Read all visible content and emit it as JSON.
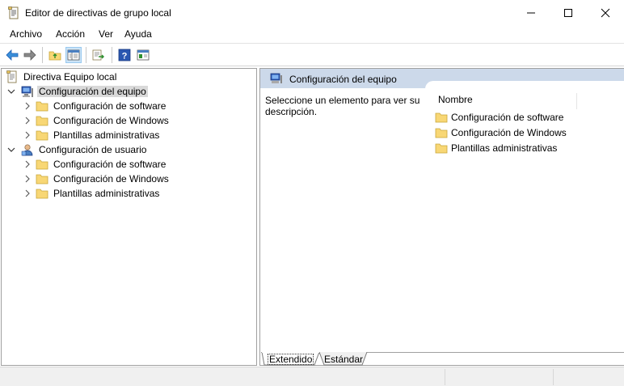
{
  "window": {
    "title": "Editor de directivas de grupo local",
    "controls": [
      "minimize",
      "maximize",
      "close"
    ]
  },
  "menu": {
    "items": [
      "Archivo",
      "Acción",
      "Ver",
      "Ayuda"
    ]
  },
  "toolbar": {
    "buttons": [
      "back-icon",
      "forward-icon",
      "up-folder-icon",
      "show-hide-tree-icon",
      "export-list-icon",
      "help-icon",
      "properties-icon"
    ]
  },
  "tree": {
    "root": "Directiva Equipo local",
    "computer": {
      "label": "Configuración del equipo",
      "children": [
        "Configuración de software",
        "Configuración de Windows",
        "Plantillas administrativas"
      ]
    },
    "user": {
      "label": "Configuración de usuario",
      "children": [
        "Configuración de software",
        "Configuración de Windows",
        "Plantillas administrativas"
      ]
    }
  },
  "details": {
    "header": "Configuración del equipo",
    "description": "Seleccione un elemento para ver su descripción.",
    "column": "Nombre",
    "items": [
      "Configuración de software",
      "Configuración de Windows",
      "Plantillas administrativas"
    ]
  },
  "tabs": {
    "extended": "Extendido",
    "standard": "Estándar"
  },
  "colors": {
    "header_bg": "#ccd9ea",
    "selection_bg": "#d9d9d9",
    "folder": "#f8d775",
    "accent_blue": "#1e5fb4"
  }
}
